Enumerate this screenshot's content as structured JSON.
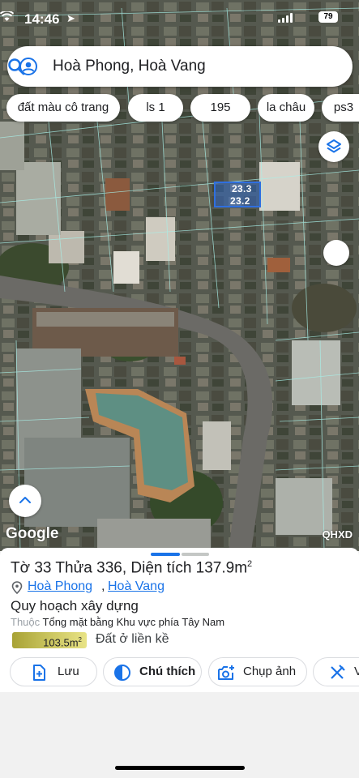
{
  "status_bar": {
    "time": "14:46",
    "battery": "79"
  },
  "search": {
    "query": "Hoà Phong, Hoà Vang",
    "account_icon": "account-circle-icon",
    "search_icon": "search-icon"
  },
  "chips": [
    "đất màu cô trang",
    "ls 1",
    "195",
    "la châu",
    "ps3"
  ],
  "map": {
    "plot_labels": [
      "23.3",
      "23.2"
    ],
    "attribution": "Google",
    "layer_code": "QHXD"
  },
  "parcel": {
    "title": "Tờ 33 Thửa 336, Diện tích 137.9m",
    "title_sup": "2",
    "location": {
      "ward": "Hoà Phong",
      "separator": ",",
      "district": "Hoà Vang"
    },
    "plan_heading": "Quy hoạch xây dựng",
    "belongs_label": "Thuộc",
    "belongs_value": "Tổng mặt bằng Khu vực phía Tây Nam",
    "zone_area": "103.5m",
    "zone_area_sup": "2",
    "zone_name": "Đất ở liền kề",
    "zone_color": "#c7c25b"
  },
  "actions": [
    {
      "label": "Lưu",
      "icon": "save-add-icon"
    },
    {
      "label": "Chú thích",
      "icon": "legend-icon"
    },
    {
      "label": "Chụp ảnh",
      "icon": "camera-add-icon"
    },
    {
      "label": "V",
      "icon": "tools-icon"
    }
  ],
  "colors": {
    "accent": "#1a73e8",
    "plot_outline": "#2f6fe0"
  }
}
